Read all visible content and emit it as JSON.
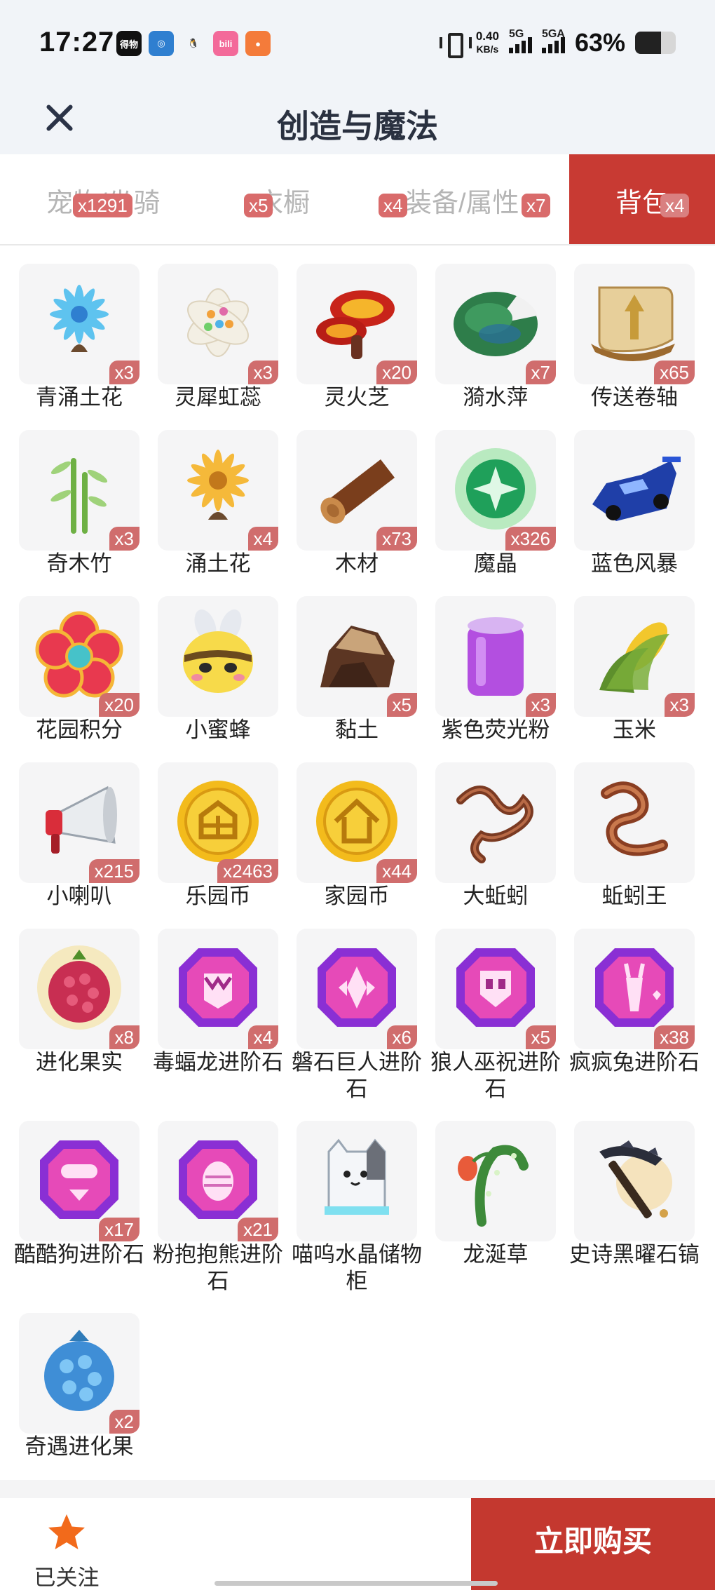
{
  "status_bar": {
    "time": "17:27",
    "apps": [
      {
        "icon": "dewu-app-icon",
        "text": "得物",
        "color": "#111111"
      },
      {
        "icon": "globe-app-icon",
        "text": "◎",
        "color": "#2f7fd0"
      },
      {
        "icon": "qq-app-icon",
        "text": "🐧",
        "color": "#f1f4f8"
      },
      {
        "icon": "bilibili-app-icon",
        "text": "bili",
        "color": "#f36a9a"
      },
      {
        "icon": "game-app-icon",
        "text": "●",
        "color": "#f47b3a"
      }
    ],
    "net_speed_value": "0.40",
    "net_speed_unit": "KB/s",
    "signal1_label": "5G",
    "signal2_label": "5GA",
    "battery_percent": "63%"
  },
  "header": {
    "title": "创造与魔法"
  },
  "tabs": [
    {
      "label": "宠物/坐骑",
      "badge": "x1291",
      "active": false
    },
    {
      "label": "衣橱",
      "badge": "x5",
      "active": false
    },
    {
      "label": "装备/属性",
      "badge": "x4",
      "active": false
    },
    {
      "label": "背包",
      "badge": "x7",
      "active": false
    },
    {
      "label": "背包",
      "badge": "x4",
      "active": true
    }
  ],
  "items": [
    {
      "name": "青涌土花",
      "qty": "x3",
      "icon": "blue-flower-icon"
    },
    {
      "name": "灵犀虹蕊",
      "qty": "x3",
      "icon": "white-flower-icon"
    },
    {
      "name": "灵火芝",
      "qty": "x20",
      "icon": "fire-mushroom-icon"
    },
    {
      "name": "漪水萍",
      "qty": "x7",
      "icon": "lily-pad-icon"
    },
    {
      "name": "传送卷轴",
      "qty": "x65",
      "icon": "scroll-icon"
    },
    {
      "name": "奇木竹",
      "qty": "x3",
      "icon": "bamboo-icon"
    },
    {
      "name": "涌土花",
      "qty": "x4",
      "icon": "yellow-flower-icon"
    },
    {
      "name": "木材",
      "qty": "x73",
      "icon": "wood-log-icon"
    },
    {
      "name": "魔晶",
      "qty": "x326",
      "icon": "magic-crystal-icon"
    },
    {
      "name": "蓝色风暴",
      "qty": "",
      "icon": "blue-racecar-icon"
    },
    {
      "name": "花园积分",
      "qty": "x20",
      "icon": "garden-points-icon"
    },
    {
      "name": "小蜜蜂",
      "qty": "",
      "icon": "bee-icon"
    },
    {
      "name": "黏土",
      "qty": "x5",
      "icon": "clay-icon"
    },
    {
      "name": "紫色荧光粉",
      "qty": "x3",
      "icon": "purple-jar-icon"
    },
    {
      "name": "玉米",
      "qty": "x3",
      "icon": "corn-icon"
    },
    {
      "name": "小喇叭",
      "qty": "x215",
      "icon": "megaphone-icon"
    },
    {
      "name": "乐园币",
      "qty": "x2463",
      "icon": "park-coin-icon"
    },
    {
      "name": "家园币",
      "qty": "x44",
      "icon": "home-coin-icon"
    },
    {
      "name": "大蚯蚓",
      "qty": "",
      "icon": "earthworm-icon"
    },
    {
      "name": "蚯蚓王",
      "qty": "",
      "icon": "worm-king-icon"
    },
    {
      "name": "进化果实",
      "qty": "x8",
      "icon": "evolution-fruit-icon"
    },
    {
      "name": "毒蝠龙进阶石",
      "qty": "x4",
      "icon": "bat-dragon-stone-icon"
    },
    {
      "name": "磐石巨人进阶石",
      "qty": "x6",
      "icon": "giant-stone-icon"
    },
    {
      "name": "狼人巫祝进阶石",
      "qty": "x5",
      "icon": "werewolf-stone-icon"
    },
    {
      "name": "疯疯兔进阶石",
      "qty": "x38",
      "icon": "rabbit-stone-icon"
    },
    {
      "name": "酷酷狗进阶石",
      "qty": "x17",
      "icon": "dog-stone-icon"
    },
    {
      "name": "粉抱抱熊进阶石",
      "qty": "x21",
      "icon": "bear-stone-icon"
    },
    {
      "name": "喵呜水晶储物柜",
      "qty": "",
      "icon": "cat-cabinet-icon"
    },
    {
      "name": "龙涎草",
      "qty": "",
      "icon": "dragon-grass-icon"
    },
    {
      "name": "史诗黑曜石镐",
      "qty": "",
      "icon": "obsidian-pickaxe-icon"
    },
    {
      "name": "奇遇进化果",
      "qty": "x2",
      "icon": "adventure-fruit-icon"
    }
  ],
  "bottom_bar": {
    "follow_label": "已关注",
    "follow_icon": "star-icon",
    "buy_label": "立即购买"
  },
  "colors": {
    "accent": "#c4382f",
    "badge": "#d06d6d",
    "star": "#f26a1b"
  }
}
